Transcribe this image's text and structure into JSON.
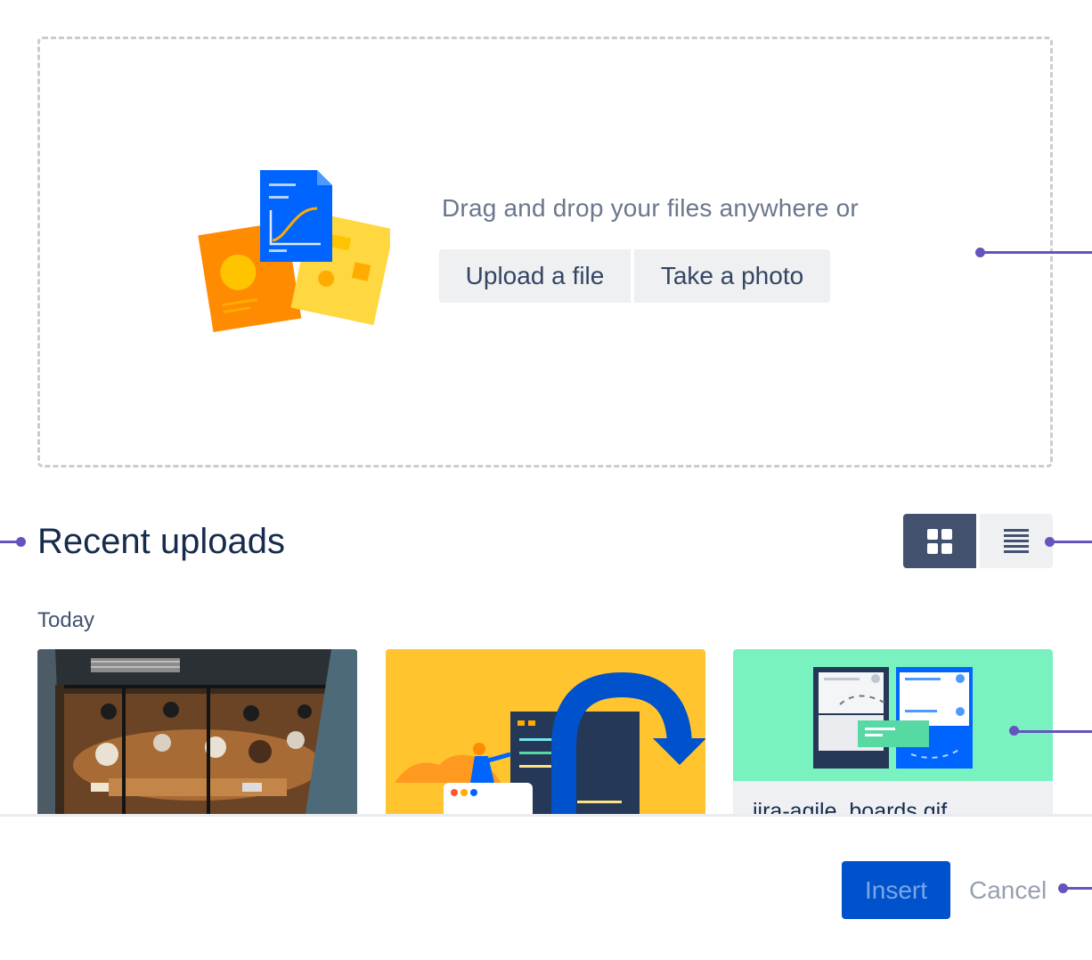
{
  "dropzone": {
    "prompt": "Drag and drop your files anywhere or",
    "upload_label": "Upload a file",
    "photo_label": "Take a photo"
  },
  "recent": {
    "title": "Recent uploads",
    "view_mode": "grid",
    "groups": [
      {
        "label": "Today",
        "items": [
          {
            "name": "",
            "thumbnail": "office-photo"
          },
          {
            "name": "",
            "thumbnail": "illustration-yellow"
          },
          {
            "name": "jira-agile_boards.gif",
            "thumbnail": "illustration-boards"
          }
        ]
      }
    ]
  },
  "footer": {
    "insert_label": "Insert",
    "cancel_label": "Cancel"
  },
  "icons": {
    "grid_view": "grid-icon",
    "list_view": "list-icon",
    "drop_illustration": "documents-illustration"
  },
  "colors": {
    "primary": "#0052cc",
    "annotation": "#6554c0",
    "toggle_active": "#42526e",
    "heading": "#172b4d",
    "muted_text": "#6b778c"
  }
}
